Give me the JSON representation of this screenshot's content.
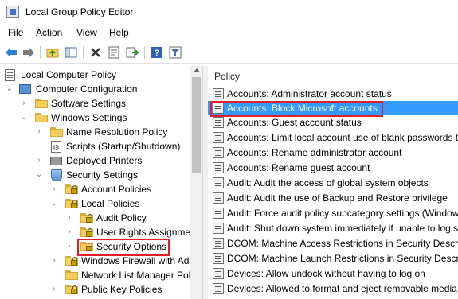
{
  "window": {
    "title": "Local Group Policy Editor"
  },
  "menu": [
    "File",
    "Action",
    "View",
    "Help"
  ],
  "toolbar": {
    "icons": [
      "back-arrow-icon",
      "forward-arrow-icon",
      "up-folder-icon",
      "show-hide-tree-icon",
      "delete-icon",
      "properties-icon",
      "export-icon",
      "help-icon",
      "filter-icon"
    ]
  },
  "tree": [
    {
      "label": "Local Computer Policy",
      "icon": "computer-icon"
    },
    {
      "label": "Computer Configuration",
      "icon": "computer-icon"
    },
    {
      "label": "Software Settings",
      "icon": "folder-icon"
    },
    {
      "label": "Windows Settings",
      "icon": "folder-icon"
    },
    {
      "label": "Name Resolution Policy",
      "icon": "folder-icon"
    },
    {
      "label": "Scripts (Startup/Shutdown)",
      "icon": "script-icon"
    },
    {
      "label": "Deployed Printers",
      "icon": "printer-icon"
    },
    {
      "label": "Security Settings",
      "icon": "shield-icon"
    },
    {
      "label": "Account Policies",
      "icon": "locked-folder-icon"
    },
    {
      "label": "Local Policies",
      "icon": "locked-folder-icon"
    },
    {
      "label": "Audit Policy",
      "icon": "locked-folder-icon"
    },
    {
      "label": "User Rights Assignmen",
      "icon": "locked-folder-icon"
    },
    {
      "label": "Security Options",
      "icon": "locked-folder-icon"
    },
    {
      "label": "Windows Firewall with Ad",
      "icon": "locked-folder-icon"
    },
    {
      "label": "Network List Manager Pol",
      "icon": "folder-icon"
    },
    {
      "label": "Public Key Policies",
      "icon": "locked-folder-icon"
    }
  ],
  "list": {
    "column_header": "Policy",
    "rows": [
      "Accounts: Administrator account status",
      "Accounts: Block Microsoft accounts",
      "Accounts: Guest account status",
      "Accounts: Limit local account use of blank passwords to",
      "Accounts: Rename administrator account",
      "Accounts: Rename guest account",
      "Audit: Audit the access of global system objects",
      "Audit: Audit the use of Backup and Restore privilege",
      "Audit: Force audit policy subcategory settings (Window",
      "Audit: Shut down system immediately if unable to log s",
      "DCOM: Machine Access Restrictions in Security Descrip",
      "DCOM: Machine Launch Restrictions in Security Descrip",
      "Devices: Allow undock without having to log on",
      "Devices: Allowed to format and eject removable media"
    ],
    "selected_index": 1
  },
  "colors": {
    "selection": "#3399ff",
    "highlight_box": "#e21e26"
  }
}
